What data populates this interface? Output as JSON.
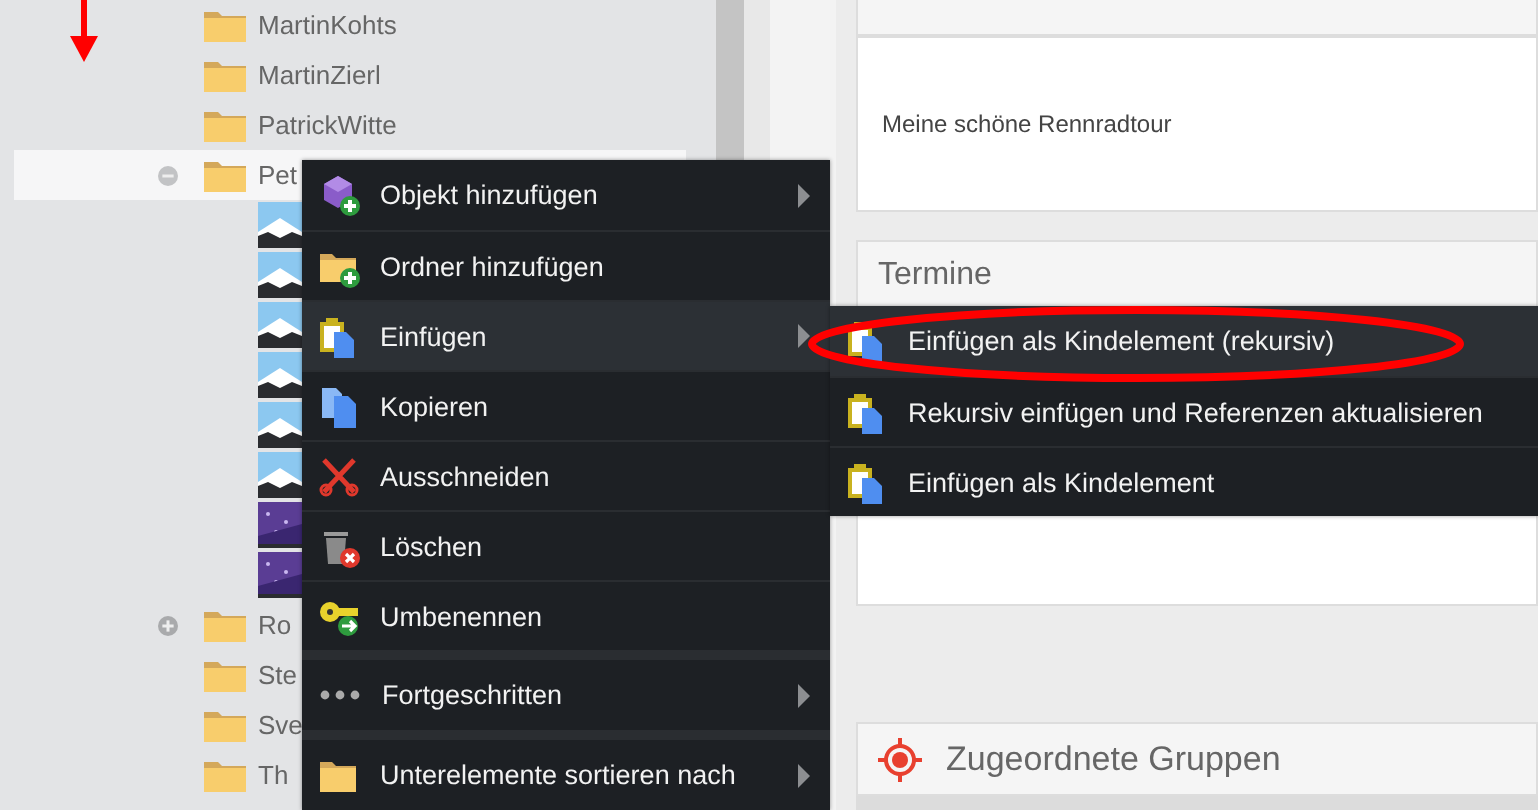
{
  "tree": {
    "items": [
      {
        "label": "MartinKohts",
        "has_children": false,
        "selected": false
      },
      {
        "label": "MartinZierl",
        "has_children": false,
        "selected": false
      },
      {
        "label": "PatrickWitte",
        "has_children": false,
        "selected": false
      },
      {
        "label": "Pet",
        "has_children": true,
        "expanded": true,
        "selected": true
      },
      {
        "label": "Ro",
        "has_children": true,
        "expanded": false,
        "selected": false
      },
      {
        "label": "Ste",
        "has_children": false,
        "selected": false
      },
      {
        "label": "Sve",
        "has_children": false,
        "selected": false
      },
      {
        "label": "Th",
        "has_children": false,
        "selected": false
      }
    ]
  },
  "context_menu": {
    "items": [
      {
        "label": "Objekt hinzufügen",
        "submenu": true,
        "selected": false,
        "section_break": false
      },
      {
        "label": "Ordner hinzufügen",
        "submenu": false,
        "selected": false,
        "section_break": false
      },
      {
        "label": "Einfügen",
        "submenu": true,
        "selected": true,
        "section_break": false
      },
      {
        "label": "Kopieren",
        "submenu": false,
        "selected": false,
        "section_break": false
      },
      {
        "label": "Ausschneiden",
        "submenu": false,
        "selected": false,
        "section_break": false
      },
      {
        "label": "Löschen",
        "submenu": false,
        "selected": false,
        "section_break": false
      },
      {
        "label": "Umbenennen",
        "submenu": false,
        "selected": false,
        "section_break": false
      },
      {
        "label": "Fortgeschritten",
        "submenu": true,
        "selected": false,
        "section_break": true
      },
      {
        "label": "Unterelemente sortieren nach",
        "submenu": true,
        "selected": false,
        "section_break": true
      }
    ]
  },
  "submenu": {
    "items": [
      {
        "label": "Einfügen als Kindelement (rekursiv)",
        "selected": true
      },
      {
        "label": "Rekursiv einfügen und Referenzen aktualisieren",
        "selected": false
      },
      {
        "label": "Einfügen als Kindelement",
        "selected": false
      }
    ]
  },
  "editor": {
    "description": "Meine schöne Rennradtour",
    "sections": [
      {
        "title": "Termine"
      },
      {
        "title": "Zugeordnete Gruppen"
      }
    ]
  },
  "annotations": [
    {
      "kind": "arrow"
    },
    {
      "kind": "ellipse"
    }
  ]
}
